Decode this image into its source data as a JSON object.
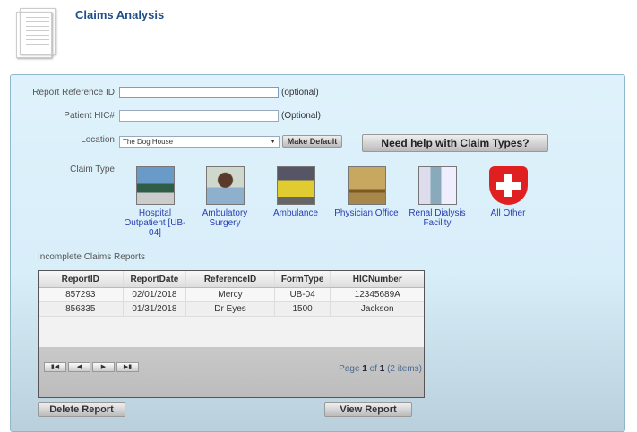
{
  "header": {
    "title": "Claims Analysis",
    "icon": "document-icon"
  },
  "form": {
    "report_ref_label": "Report Reference ID",
    "report_ref_value": "",
    "report_ref_hint": "(optional)",
    "hic_label": "Patient HIC#",
    "hic_value": "",
    "hic_hint": "(Optional)",
    "location_label": "Location",
    "location_value": "The Dog House",
    "make_default": "Make Default",
    "help_button": "Need help with Claim Types?",
    "claim_type_label": "Claim Type"
  },
  "claim_types": [
    {
      "label": "Hospital Outpatient [UB-04]",
      "color": "#4a7a6a"
    },
    {
      "label": "Ambulatory Surgery",
      "color": "#8aa6b8"
    },
    {
      "label": "Ambulance",
      "color": "#d8c440"
    },
    {
      "label": "Physician Office",
      "color": "#a08040"
    },
    {
      "label": "Renal Dialysis Facility",
      "color": "#b8c4cc"
    },
    {
      "label": "All Other",
      "color": "#e02020"
    }
  ],
  "reports": {
    "title": "Incomplete Claims Reports",
    "columns": [
      "ReportID",
      "ReportDate",
      "ReferenceID",
      "FormType",
      "HICNumber"
    ],
    "rows": [
      [
        "857293",
        "02/01/2018",
        "Mercy",
        "UB-04",
        "12345689A"
      ],
      [
        "856335",
        "01/31/2018",
        "Dr Eyes",
        "1500",
        "Jackson"
      ]
    ],
    "pager": {
      "prefix": "Page ",
      "page": "1",
      "of": " of ",
      "total": "1",
      "items": " (2 items)"
    }
  },
  "actions": {
    "delete": "Delete Report",
    "view": "View Report"
  }
}
